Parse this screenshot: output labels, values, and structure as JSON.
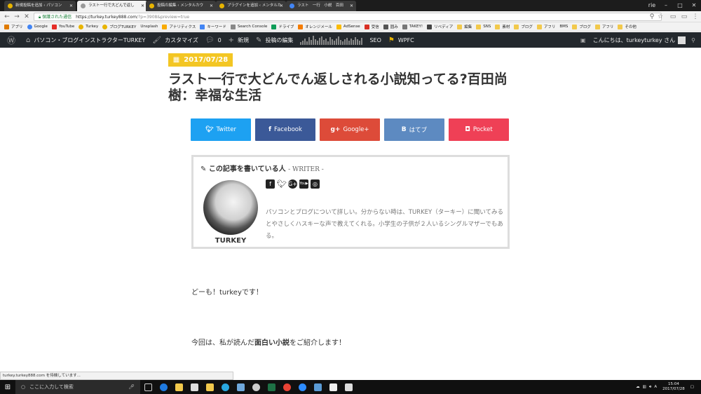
{
  "browser": {
    "tabs": [
      {
        "title": "新規投稿を追加 ‹ パソコン"
      },
      {
        "title": "ラスト一行で大どんで返し",
        "active": true
      },
      {
        "title": "投稿の編集 ‹ メンタルカウ"
      },
      {
        "title": "プラグインを追加 ‹ メンタルカ"
      },
      {
        "title": "ラスト　一行　小説　百田"
      }
    ],
    "profile": "rie",
    "secure_label": "保護された通信",
    "url_host": "https://turkey.turkey888.com",
    "url_path": "/?p=3908&preview=true",
    "bookmarks": [
      "アプリ",
      "Google",
      "YouTube",
      "Turkey",
      "ブログTURKEY",
      "Unsplash",
      "アナリティクス",
      "キーワード",
      "Search Console",
      "ドライブ",
      "オレンジメール",
      "AdSense",
      "受信",
      "囲み",
      "TAKEY!",
      "リベディア",
      "編集",
      "SNS",
      "素材",
      "ブログ",
      "アフリ",
      "BMS",
      "ブログ",
      "アフリ",
      "その他"
    ]
  },
  "wpbar": {
    "site": "パソコン・ブログインストラクターTURKEY",
    "customize": "カスタマイズ",
    "comments": "0",
    "new": "新規",
    "edit": "投稿の編集",
    "seo": "SEO",
    "wpfc": "WPFC",
    "greeting": "こんにちは、turkeyturkey さん"
  },
  "post": {
    "date": "2017/07/28",
    "title": "ラスト一行で大どんでん返しされる小説知ってる?百田尚樹：幸福な生活",
    "share": {
      "twitter": "Twitter",
      "facebook": "Facebook",
      "google": "Google+",
      "hatena": "はてブ",
      "pocket": "Pocket"
    },
    "writer": {
      "heading": "この記事を書いている人",
      "heading_sub": "- WRITER -",
      "name": "TURKEY",
      "description": "パソコンとブログについて詳しい。分からない時は、TURKEY（ターキー）に聞いてみるとやさしくハスキーな声で教えてくれる。小学生の子供が２人いるシングルマザーでもある。"
    },
    "para1": "どーも！turkeyです！",
    "para2_before": "今回は、私が読んだ",
    "para2_bold": "面白い小説",
    "para2_after": "をご紹介します！"
  },
  "status": "turkey.turkey888.com を待機しています...",
  "taskbar": {
    "search_placeholder": "ここに入力して検索",
    "time": "15:04",
    "date": "2017/07/28"
  },
  "colors": {
    "twitter": "#1da1f2",
    "facebook": "#3b5998",
    "google": "#dd4b39",
    "hatena": "#5d8ac1",
    "pocket": "#ef4056",
    "date_badge": "#f3c623"
  }
}
